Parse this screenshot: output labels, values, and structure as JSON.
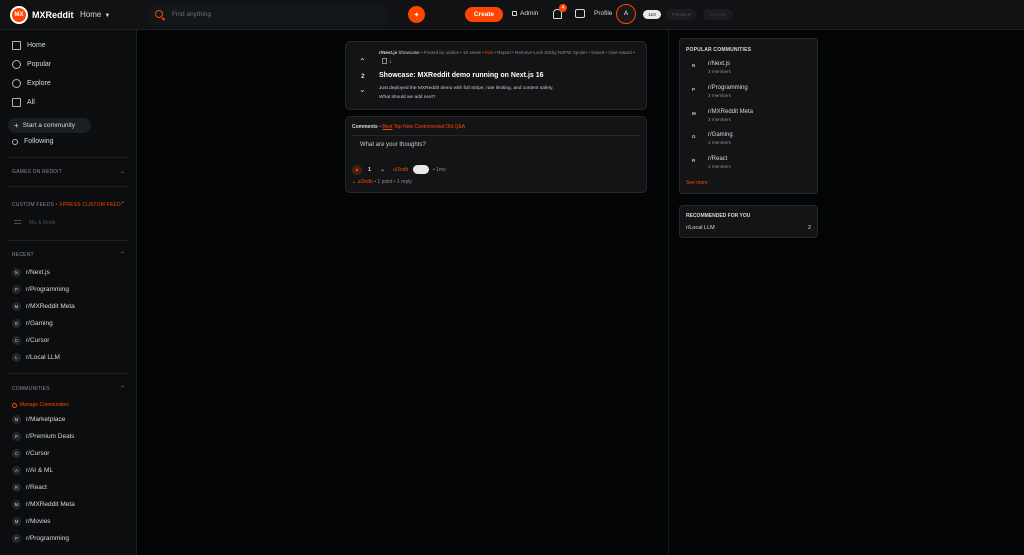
{
  "header": {
    "logo_text": "MX",
    "brand": "MXReddit",
    "home_dropdown": "Home",
    "search_placeholder": "Find anything",
    "create_label": "Create",
    "admin_label": "Admin",
    "notification_count": "4",
    "profile_label": "Profile",
    "avatar_letter": "A",
    "pill1": "1e3",
    "pill2": "Friends ▾",
    "pill3": "Get App"
  },
  "sidebar": {
    "nav": [
      {
        "label": "Home",
        "icon": "home-icon"
      },
      {
        "label": "Popular",
        "icon": "popular-icon"
      },
      {
        "label": "Explore",
        "icon": "explore-icon"
      },
      {
        "label": "All",
        "icon": "all-icon"
      }
    ],
    "start_community": "Start a community",
    "following": "Following",
    "games_header": "GAMES ON REDDIT",
    "custom_feeds_header": "CUSTOM FEEDS",
    "custom_feeds_suffix": "• XPRESS CUSTOM FEED",
    "multi_item": "Mix & Mode",
    "recent_header": "RECENT",
    "recent": [
      {
        "av": "N",
        "name": "r/Next.js"
      },
      {
        "av": "P",
        "name": "r/Programming"
      },
      {
        "av": "M",
        "name": "r/MXReddit Meta"
      },
      {
        "av": "G",
        "name": "r/Gaming"
      },
      {
        "av": "C",
        "name": "r/Cursor"
      },
      {
        "av": "L",
        "name": "r/Local LLM"
      }
    ],
    "communities_header": "COMMUNITIES",
    "manage_label": "Manage Communities",
    "communities": [
      {
        "av": "M",
        "name": "r/Marketplace"
      },
      {
        "av": "P",
        "name": "r/Premium Deals"
      },
      {
        "av": "C",
        "name": "r/Cursor"
      },
      {
        "av": "A",
        "name": "r/AI & ML"
      },
      {
        "av": "R",
        "name": "r/React"
      },
      {
        "av": "M",
        "name": "r/MXReddit Meta"
      },
      {
        "av": "M",
        "name": "r/Movies"
      },
      {
        "av": "P",
        "name": "r/Programming"
      }
    ]
  },
  "post": {
    "subreddit": "r/Next.js",
    "flair": "Showcase",
    "posted_by": "• Posted by u/alice • 10 views •",
    "edit": "Edit",
    "actions": "• Report • Remove Lock Sticky NSFW Spoiler • Saved",
    "give_award": "• Give Award •",
    "award_count": "1",
    "vote_count": "2",
    "title": "Showcase: MXReddit demo running on Next.js 16",
    "body_line1": "Just deployed the MXReddit demo with full Stripe, rate limiting, and content safety.",
    "body_line2": "What should we add next?"
  },
  "comments": {
    "label": "Comments",
    "sort_best": "Best",
    "sort_rest": "Top New Controversial Old Q&A",
    "input_placeholder": "What are your thoughts?",
    "vote_count": "1",
    "user": "u/2ndb",
    "age": "• 1mo",
    "footer_user": "u/2ndb",
    "footer_meta": "• 1 point • 1 reply"
  },
  "right_rail": {
    "popular_header": "POPULAR COMMUNITIES",
    "communities": [
      {
        "av": "N",
        "name": "r/Next.js",
        "members": "3 members"
      },
      {
        "av": "P",
        "name": "r/Programming",
        "members": "3 members"
      },
      {
        "av": "M",
        "name": "r/MXReddit Meta",
        "members": "3 members"
      },
      {
        "av": "G",
        "name": "r/Gaming",
        "members": "3 members"
      },
      {
        "av": "R",
        "name": "r/React",
        "members": "3 members"
      }
    ],
    "see_more": "See more",
    "recommended_header": "RECOMMENDED FOR YOU",
    "recommended_name": "r/Local LLM",
    "recommended_count": "2"
  },
  "colors": {
    "accent": "#ff4500",
    "background": "#030406",
    "card": "#131416"
  }
}
